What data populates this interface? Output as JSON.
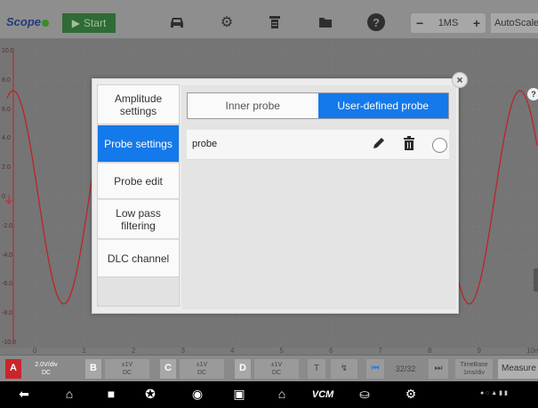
{
  "toolbar": {
    "logo": "Scope",
    "start_label": "Start",
    "icons": [
      "car-icon",
      "gear-icon",
      "print-icon",
      "folder-icon",
      "help-icon"
    ],
    "timebase_value": "1MS",
    "autoscale_label": "AutoScale"
  },
  "plot": {
    "y_ticks": [
      "10.0",
      "8.0",
      "6.0",
      "4.0",
      "2.0",
      "0",
      "-2.0",
      "-4.0",
      "-6.0",
      "-8.0",
      "-10.0"
    ],
    "x_ticks": [
      "0",
      "1",
      "2",
      "3",
      "4",
      "5",
      "6",
      "7",
      "8",
      "9",
      "10ms"
    ],
    "trace_color": "#c8262a",
    "help_badge": "?"
  },
  "channels": {
    "a": {
      "letter": "A",
      "scale": "2.0V/div",
      "coupling": "DC",
      "color": "#c8262a"
    },
    "b": {
      "letter": "B",
      "scale": "±1V",
      "coupling": "DC"
    },
    "c": {
      "letter": "C",
      "scale": "±1V",
      "coupling": "DC"
    },
    "d": {
      "letter": "D",
      "scale": "±1V",
      "coupling": "DC"
    },
    "trigger_t": "T",
    "page": "32/32",
    "timebase_label": "TimeBase",
    "timebase_unit": "1ms/div",
    "measure_label": "Measure"
  },
  "dialog": {
    "sidebar": [
      {
        "label": "Amplitude settings",
        "active": false
      },
      {
        "label": "Probe settings",
        "active": true
      },
      {
        "label": "Probe edit",
        "active": false
      },
      {
        "label": "Low pass filtering",
        "active": false
      },
      {
        "label": "DLC channel",
        "active": false
      }
    ],
    "tabs": {
      "inner": "Inner probe",
      "user": "User-defined probe"
    },
    "probe_name": "probe",
    "accent": "#1479ea"
  },
  "navbar": {
    "icons": [
      "back-icon",
      "home-icon",
      "recents-icon",
      "vci-icon",
      "camera-icon",
      "screenshot-icon",
      "house-icon",
      "vcm-icon",
      "car-icon",
      "wifi-car-icon"
    ],
    "vcm_label": "VCM"
  }
}
